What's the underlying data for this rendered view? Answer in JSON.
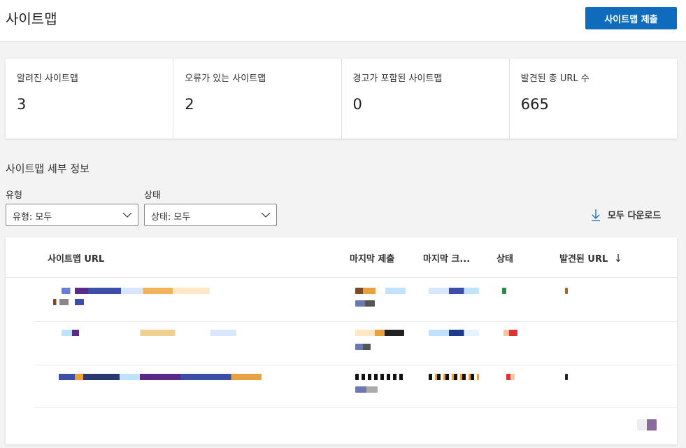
{
  "header": {
    "title": "사이트맵",
    "submit_label": "사이트맵 제출"
  },
  "stats": [
    {
      "label": "알려진 사이트맵",
      "value": "3"
    },
    {
      "label": "오류가 있는 사이트맵",
      "value": "2"
    },
    {
      "label": "경고가 포함된 사이트맵",
      "value": "0"
    },
    {
      "label": "발견된 총 URL 수",
      "value": "665"
    }
  ],
  "details": {
    "title": "사이트맵 세부 정보",
    "filters": {
      "type_label": "유형",
      "type_value": "유형: 모두",
      "status_label": "상태",
      "status_value": "상태: 모두"
    },
    "download_label": "모두 다운로드"
  },
  "table": {
    "columns": [
      "사이트맵 URL",
      "마지막 제출",
      "마지막 크...",
      "상태",
      "발견된 URL"
    ],
    "sort_indicator": "↓",
    "rows_note": "row contents are pixelated/redacted in screenshot"
  },
  "colors": {
    "accent": "#0f6cbd",
    "text": "#323130",
    "background": "#f3f3f3"
  }
}
